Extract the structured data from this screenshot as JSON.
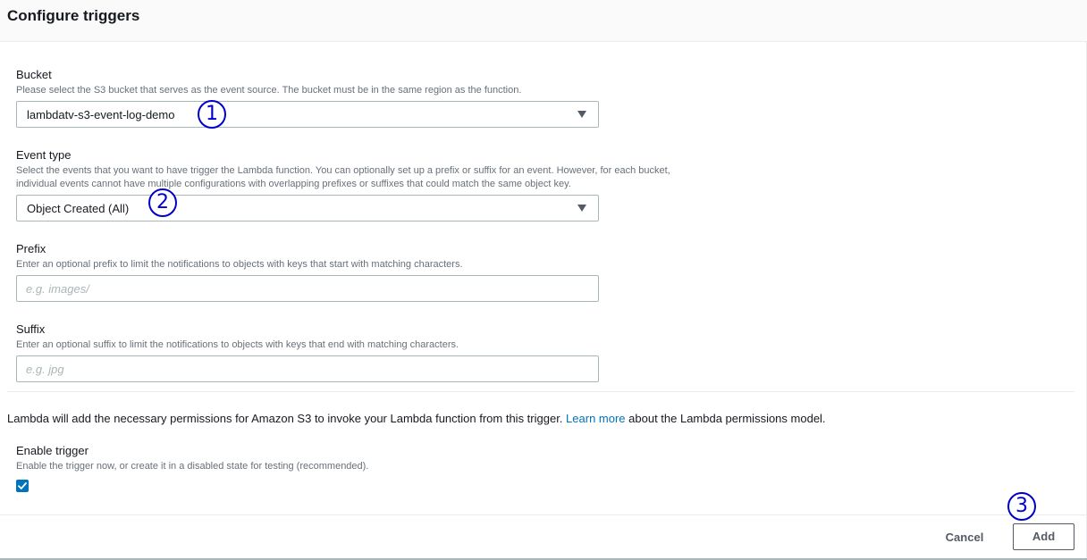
{
  "header": {
    "title": "Configure triggers"
  },
  "bucket": {
    "label": "Bucket",
    "description": "Please select the S3 bucket that serves as the event source. The bucket must be in the same region as the function.",
    "selected": "lambdatv-s3-event-log-demo"
  },
  "event_type": {
    "label": "Event type",
    "description_line1": "Select the events that you want to have trigger the Lambda function. You can optionally set up a prefix or suffix for an event. However, for each bucket,",
    "description_line2": "individual events cannot have multiple configurations with overlapping prefixes or suffixes that could match the same object key.",
    "selected": "Object Created (All)"
  },
  "prefix": {
    "label": "Prefix",
    "description": "Enter an optional prefix to limit the notifications to objects with keys that start with matching characters.",
    "placeholder": "e.g. images/",
    "value": ""
  },
  "suffix": {
    "label": "Suffix",
    "description": "Enter an optional suffix to limit the notifications to objects with keys that end with matching characters.",
    "placeholder": "e.g. jpg",
    "value": ""
  },
  "permissions": {
    "text_before": "Lambda will add the necessary permissions for Amazon S3 to invoke your Lambda function from this trigger. ",
    "link_text": "Learn more",
    "text_after": " about the Lambda permissions model."
  },
  "enable_trigger": {
    "label": "Enable trigger",
    "description": "Enable the trigger now, or create it in a disabled state for testing (recommended).",
    "checked": true
  },
  "footer": {
    "cancel_label": "Cancel",
    "add_label": "Add"
  },
  "annotations": [
    "1",
    "2",
    "3"
  ],
  "colors": {
    "link": "#0073bb",
    "checkbox": "#0073bb",
    "annotation": "#0000cc"
  }
}
